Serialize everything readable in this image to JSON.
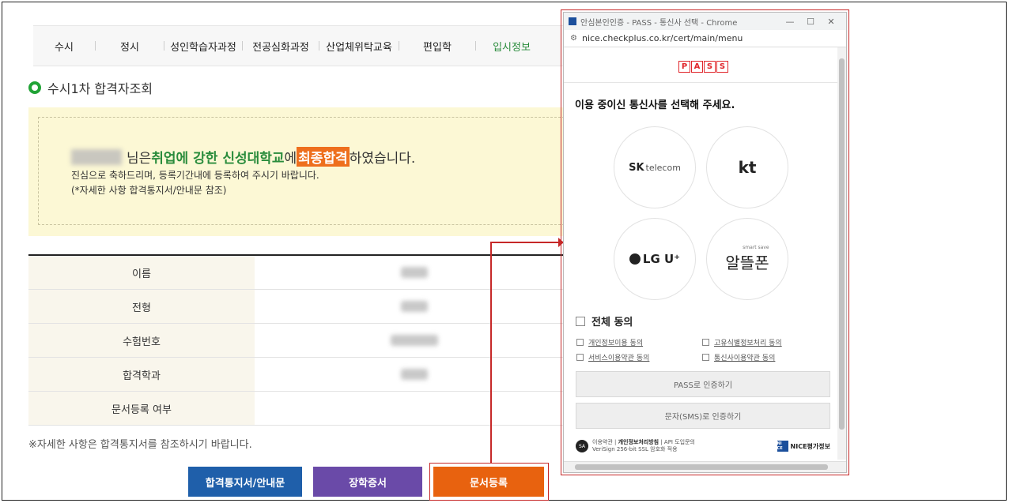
{
  "nav": {
    "items": [
      "수시",
      "정시",
      "성인학습자과정",
      "전공심화과정",
      "산업체위탁교육",
      "편입학",
      "입시정보"
    ],
    "active_index": 6
  },
  "section_title": "수시1차 합격자조회",
  "notice": {
    "suffix_1": "님은 ",
    "green_text": "취업에 강한 신성대학교",
    "mid": "에 ",
    "orange_text": "최종합격",
    "end": "하였습니다.",
    "line2": "진심으로 축하드리며, 등록기간내에 등록하여 주시기 바랍니다.",
    "line3": "(*자세한 사항 합격통지서/안내문 참조)"
  },
  "table": {
    "rows": [
      "이름",
      "전형",
      "수험번호",
      "합격학과",
      "문서등록 여부"
    ]
  },
  "footnote": "※자세한 사항은 합격통지서를 참조하시기 바랍니다.",
  "buttons": {
    "notice_doc": "합격통지서/안내문",
    "scholarship": "장학증서",
    "doc_register": "문서등록"
  },
  "colors": {
    "accent_green": "#2a8c3c",
    "highlight_orange": "#ee6f1d",
    "btn_blue": "#1f5faa",
    "btn_purple": "#6a4aa8",
    "btn_orange": "#e8620f",
    "annotation_red": "#c62828"
  },
  "popup": {
    "window_title": "안심본인인증 - PASS - 통신사 선택 - Chrome",
    "url": "nice.checkplus.co.kr/cert/main/menu",
    "logo_letters": [
      "P",
      "A",
      "S",
      "S"
    ],
    "heading": "이용 중이신 통신사를 선택해 주세요.",
    "carriers": {
      "sk_main": "SK",
      "sk_sub": "telecom",
      "kt": "kt",
      "lg": "LG U⁺",
      "alt_small": "smart save",
      "alt": "알뜰폰"
    },
    "agree_all": "전체 동의",
    "agreements": [
      "개인정보이용 동의",
      "고유식별정보처리 동의",
      "서비스이용약관 동의",
      "통신사이용약관 동의"
    ],
    "pass_button": "PASS로 인증하기",
    "sms_button": "문자(SMS)로 인증하기",
    "footer": {
      "terms": "이용약관",
      "privacy": "개인정보처리방침",
      "api": "API 도입문의",
      "ssl": "VeriSign 256-bit SSL 암호화 적용",
      "sa_badge": "SA",
      "nice_badge": "NI CE",
      "nice": "NICE평가정보"
    }
  }
}
